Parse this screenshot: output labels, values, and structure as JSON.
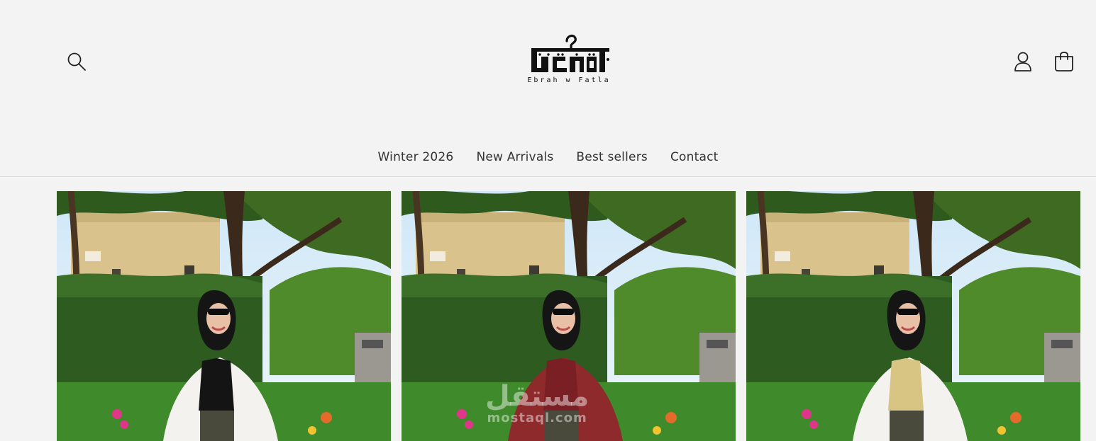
{
  "brand": {
    "logo_latin": "Ebrah w Fatla",
    "logo_arabic": "ابرة وفتلة"
  },
  "header": {
    "search_icon": "search-icon",
    "account_icon": "user-icon",
    "cart_icon": "shopping-bag-icon"
  },
  "nav": {
    "items": [
      "Winter 2026",
      "New Arrivals",
      "Best sellers",
      "Contact"
    ]
  },
  "products": [
    {
      "image": "woman-in-hijab-white-shirt-black-top-garden",
      "outfit_color": "#f4f2ee"
    },
    {
      "image": "woman-in-hijab-burgundy-shirt-garden",
      "outfit_color": "#8e2a2c"
    },
    {
      "image": "woman-in-hijab-white-shirt-beige-top-garden",
      "outfit_color": "#f4f2ee"
    }
  ],
  "watermark": {
    "arabic": "مستقل",
    "latin": "mostaql.com"
  },
  "colors": {
    "background": "#f3f3f3",
    "text": "#333333",
    "divider": "#dcdcdc"
  }
}
